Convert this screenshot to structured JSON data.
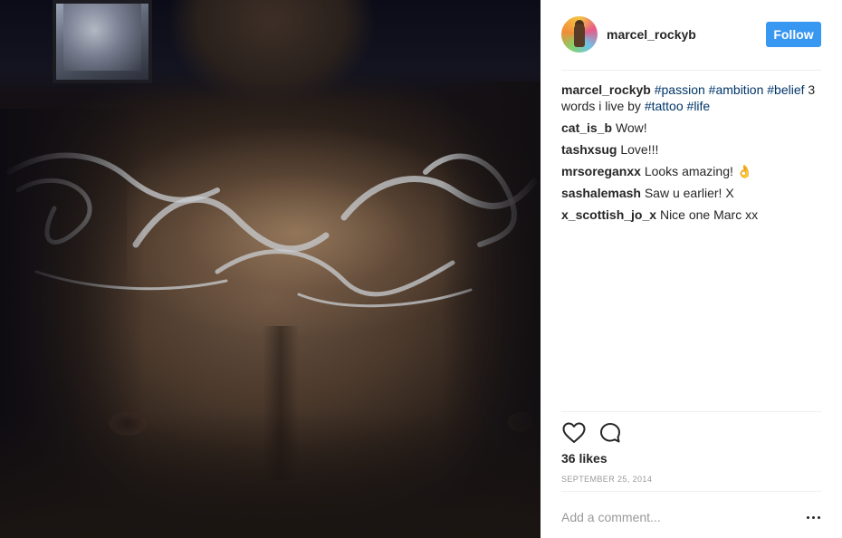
{
  "post": {
    "image_alt": "Chest tattoo photo",
    "tattoo_text": "Passion Ambition Belief"
  },
  "header": {
    "username": "marcel_rockyb",
    "follow_label": "Follow",
    "avatar_icon": "avatar-image"
  },
  "caption": {
    "username": "marcel_rockyb",
    "parts": [
      {
        "type": "tag",
        "text": "#passion"
      },
      {
        "type": "text",
        "text": " "
      },
      {
        "type": "tag",
        "text": "#ambition"
      },
      {
        "type": "text",
        "text": " "
      },
      {
        "type": "tag",
        "text": "#belief"
      },
      {
        "type": "text",
        "text": " 3 words i live by "
      },
      {
        "type": "tag",
        "text": "#tattoo"
      },
      {
        "type": "text",
        "text": " "
      },
      {
        "type": "tag",
        "text": "#life"
      }
    ]
  },
  "comments": [
    {
      "username": "cat_is_b",
      "text": "Wow!"
    },
    {
      "username": "tashxsug",
      "text": "Love!!!"
    },
    {
      "username": "mrsoreganxx",
      "text": "Looks amazing! 👌"
    },
    {
      "username": "sashalemash",
      "text": "Saw u earlier! X"
    },
    {
      "username": "x_scottish_jo_x",
      "text": "Nice one Marc xx"
    }
  ],
  "actions": {
    "like_icon": "heart-icon",
    "comment_icon": "comment-bubble-icon"
  },
  "likes_text": "36 likes",
  "timestamp": "SEPTEMBER 25, 2014",
  "add_comment": {
    "placeholder": "Add a comment...",
    "more_icon": "more-options-icon"
  },
  "colors": {
    "follow_button": "#3897f0",
    "hashtag": "#003569",
    "text": "#262626",
    "muted": "#999999",
    "divider": "#efefef"
  }
}
